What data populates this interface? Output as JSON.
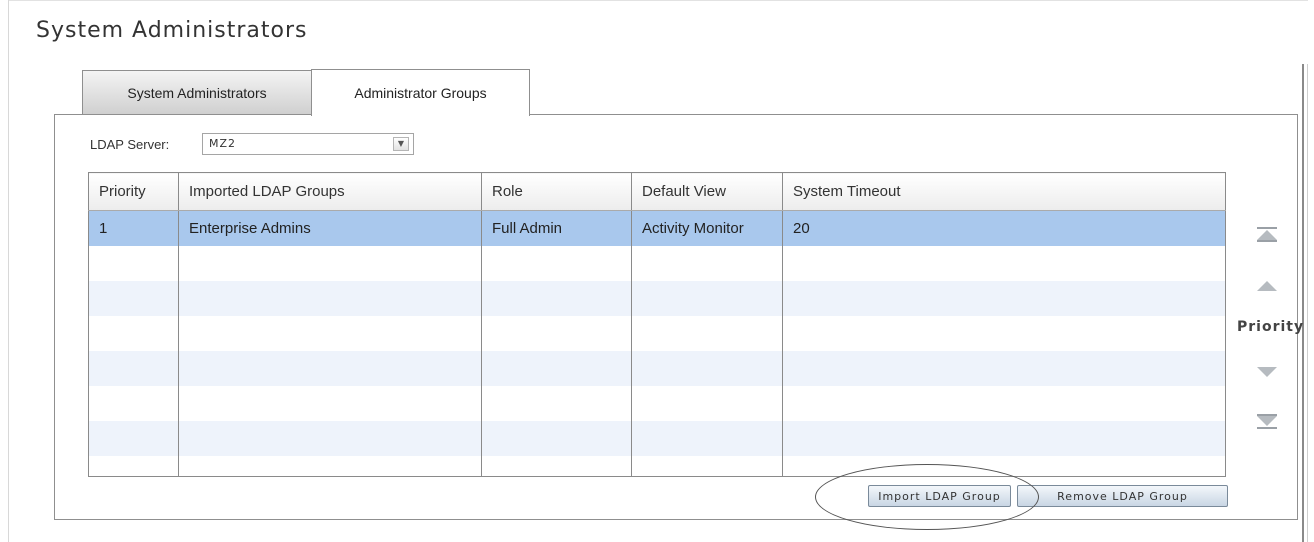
{
  "page": {
    "title": "System Administrators"
  },
  "tabs": [
    {
      "label": "System Administrators",
      "active": false
    },
    {
      "label": "Administrator Groups",
      "active": true
    }
  ],
  "ldap": {
    "label": "LDAP Server:",
    "selected": "MZ2"
  },
  "table": {
    "columns": [
      "Priority",
      "Imported LDAP Groups",
      "Role",
      "Default View",
      "System Timeout"
    ],
    "rows": [
      [
        "1",
        "Enterprise Admins",
        "Full Admin",
        "Activity Monitor",
        "20"
      ]
    ],
    "selected_row_color": "#a9c8ed",
    "alt_row_color": "#eef3fb"
  },
  "priority_controls": {
    "label": "Priority",
    "icons": [
      "move-top-icon",
      "move-up-icon",
      "move-down-icon",
      "move-bottom-icon"
    ]
  },
  "buttons": {
    "import": "Import LDAP Group",
    "remove": "Remove LDAP Group"
  }
}
